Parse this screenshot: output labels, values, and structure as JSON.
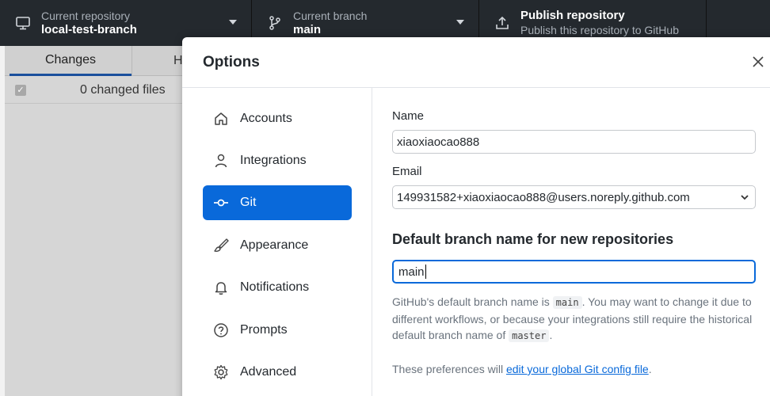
{
  "toolbar": {
    "repo": {
      "label": "Current repository",
      "value": "local-test-branch"
    },
    "branch": {
      "label": "Current branch",
      "value": "main"
    },
    "publish": {
      "title": "Publish repository",
      "subtitle": "Publish this repository to GitHub"
    }
  },
  "left_panel": {
    "tabs": [
      "Changes",
      "His"
    ],
    "changed_files": "0 changed files"
  },
  "modal": {
    "title": "Options",
    "close_icon": "close-icon",
    "nav": [
      {
        "label": "Accounts",
        "icon": "home-icon",
        "selected": false
      },
      {
        "label": "Integrations",
        "icon": "person-icon",
        "selected": false
      },
      {
        "label": "Git",
        "icon": "git-commit-icon",
        "selected": true
      },
      {
        "label": "Appearance",
        "icon": "paintbrush-icon",
        "selected": false
      },
      {
        "label": "Notifications",
        "icon": "bell-icon",
        "selected": false
      },
      {
        "label": "Prompts",
        "icon": "question-icon",
        "selected": false
      },
      {
        "label": "Advanced",
        "icon": "gear-icon",
        "selected": false
      }
    ],
    "git": {
      "name_label": "Name",
      "name_value": "xiaoxiaocao888",
      "email_label": "Email",
      "email_value": "149931582+xiaoxiaocao888@users.noreply.github.com",
      "branch_heading": "Default branch name for new repositories",
      "branch_value": "main",
      "help_part1": "GitHub's default branch name is ",
      "help_code1": "main",
      "help_part2": ". You may want to change it due to different workflows, or because your integrations still require the historical default branch name of ",
      "help_code2": "master",
      "help_part3": ".",
      "prefs_prefix": "These preferences will ",
      "prefs_link": "edit your global Git config file",
      "prefs_suffix": "."
    }
  },
  "colors": {
    "accent": "#0969da",
    "toolbar_bg": "#24292e",
    "text": "#24292e",
    "muted": "#6a737d"
  }
}
